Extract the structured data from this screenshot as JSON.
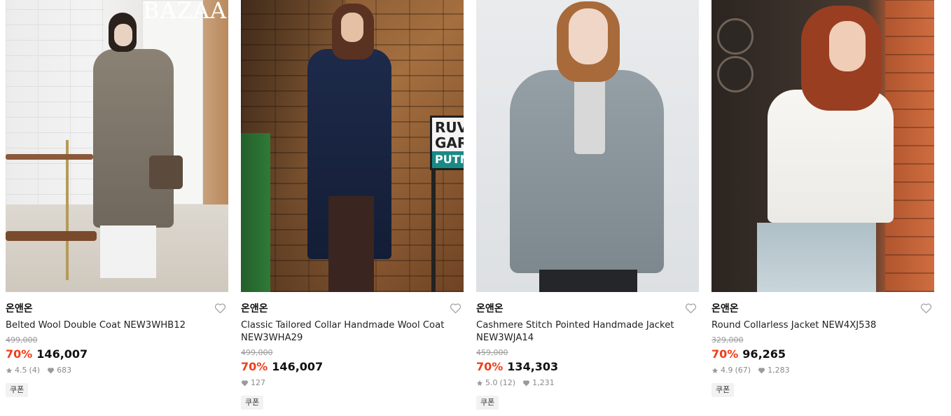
{
  "products": [
    {
      "brand": "온앤온",
      "title": "Belted Wool Double Coat NEW3WHB12",
      "original_price": "499,000",
      "discount": "70%",
      "price": "146,007",
      "rating": "4.5",
      "reviews": "(4)",
      "likes": "683",
      "coupon": "쿠폰",
      "image_text": "BAZAAR"
    },
    {
      "brand": "온앤온",
      "title": "Classic Tailored Collar Handmade Wool Coat NEW3WHA29",
      "original_price": "499,000",
      "discount": "70%",
      "price": "146,007",
      "likes": "127",
      "coupon": "쿠폰",
      "sign_lines": [
        "RUV",
        "GAR",
        "PUTN"
      ]
    },
    {
      "brand": "온앤온",
      "title": "Cashmere Stitch Pointed Handmade Jacket NEW3WJA14",
      "original_price": "459,000",
      "discount": "70%",
      "price": "134,303",
      "rating": "5.0",
      "reviews": "(12)",
      "likes": "1,231",
      "coupon": "쿠폰"
    },
    {
      "brand": "온앤온",
      "title": "Round Collarless Jacket NEW4XJ538",
      "original_price": "329,000",
      "discount": "70%",
      "price": "96,265",
      "rating": "4.9",
      "reviews": "(67)",
      "likes": "1,283",
      "coupon": "쿠폰"
    }
  ],
  "colors": {
    "discount": "#ef3e1a",
    "meta": "#8a8a8a"
  }
}
